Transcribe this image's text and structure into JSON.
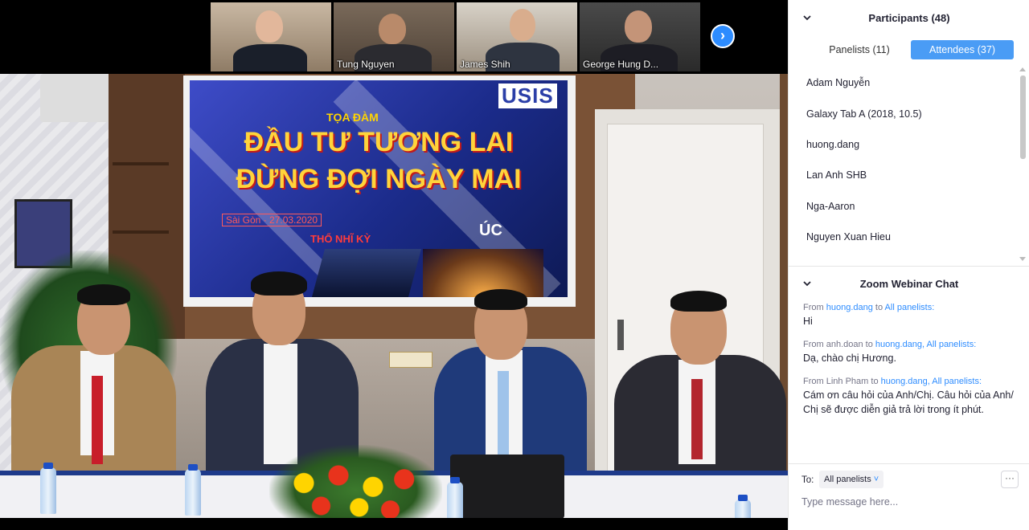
{
  "video": {
    "thumbnails": [
      {
        "name": ""
      },
      {
        "name": "Tung Nguyen"
      },
      {
        "name": "James Shih"
      },
      {
        "name": "George Hung D..."
      }
    ],
    "next_icon": "chevron-right-icon",
    "slide": {
      "logo": "USIS",
      "subtitle": "TỌA ĐÀM",
      "title_line1": "ĐẦU TƯ TƯƠNG LAI",
      "title_line2": "ĐỪNG ĐỢI NGÀY MAI",
      "date": "Sài Gòn · 27.03.2020",
      "tag_left": "THỔ NHĨ KỲ",
      "tag_right": "ÚC"
    }
  },
  "participants": {
    "title": "Participants (48)",
    "tabs": [
      {
        "label": "Panelists (11)",
        "active": false
      },
      {
        "label": "Attendees (37)",
        "active": true
      }
    ],
    "items": [
      "Adam Nguyễn",
      "Galaxy Tab A (2018, 10.5)",
      "huong.dang",
      "Lan Anh SHB",
      "Nga-Aaron",
      "Nguyen Xuan Hieu"
    ]
  },
  "chat": {
    "title": "Zoom Webinar Chat",
    "messages": [
      {
        "from_prefix": "From ",
        "from": "huong.dang",
        "to_prefix": " to ",
        "to": "All panelists:",
        "text": "Hi"
      },
      {
        "from_prefix": "From ",
        "from": "anh.doan",
        "to_prefix": " to ",
        "to": "huong.dang, All panelists:",
        "text": "Dạ, chào chị Hương."
      },
      {
        "from_prefix": "From ",
        "from": "Linh Pham",
        "to_prefix": " to ",
        "to": "huong.dang, All panelists:",
        "text": "Cám ơn câu hỏi của Anh/Chị. Câu hỏi của Anh/ Chị sẽ được diễn giả trả lời trong ít phút."
      }
    ],
    "to_label": "To:",
    "to_value": "All panelists",
    "more_label": "···",
    "placeholder": "Type message here..."
  },
  "colors": {
    "accent": "#2d8cff",
    "tab_active": "#4a9cf5",
    "text": "#232333",
    "muted": "#747487"
  }
}
